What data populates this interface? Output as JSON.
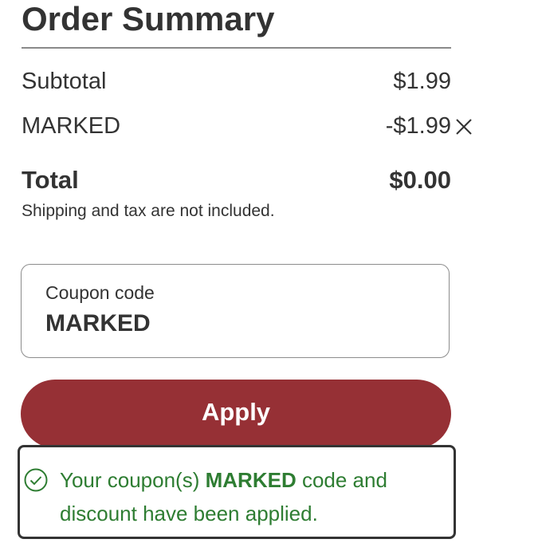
{
  "title": "Order Summary",
  "summary": {
    "subtotal_label": "Subtotal",
    "subtotal_value": "$1.99",
    "coupon_label": "MARKED",
    "coupon_value": "-$1.99",
    "total_label": "Total",
    "total_value": "$0.00",
    "note": "Shipping and tax are not included."
  },
  "coupon_field": {
    "label": "Coupon code",
    "value": "MARKED"
  },
  "apply_button": {
    "label": "Apply"
  },
  "success_message": {
    "prefix": "Your coupon(s) ",
    "code": "MARKED",
    "suffix": " code and discount have been applied."
  },
  "icons": {
    "remove": "close-icon",
    "success": "check-circle-icon"
  },
  "colors": {
    "accent": "#963035",
    "success": "#2e7d32",
    "text": "#333333"
  }
}
